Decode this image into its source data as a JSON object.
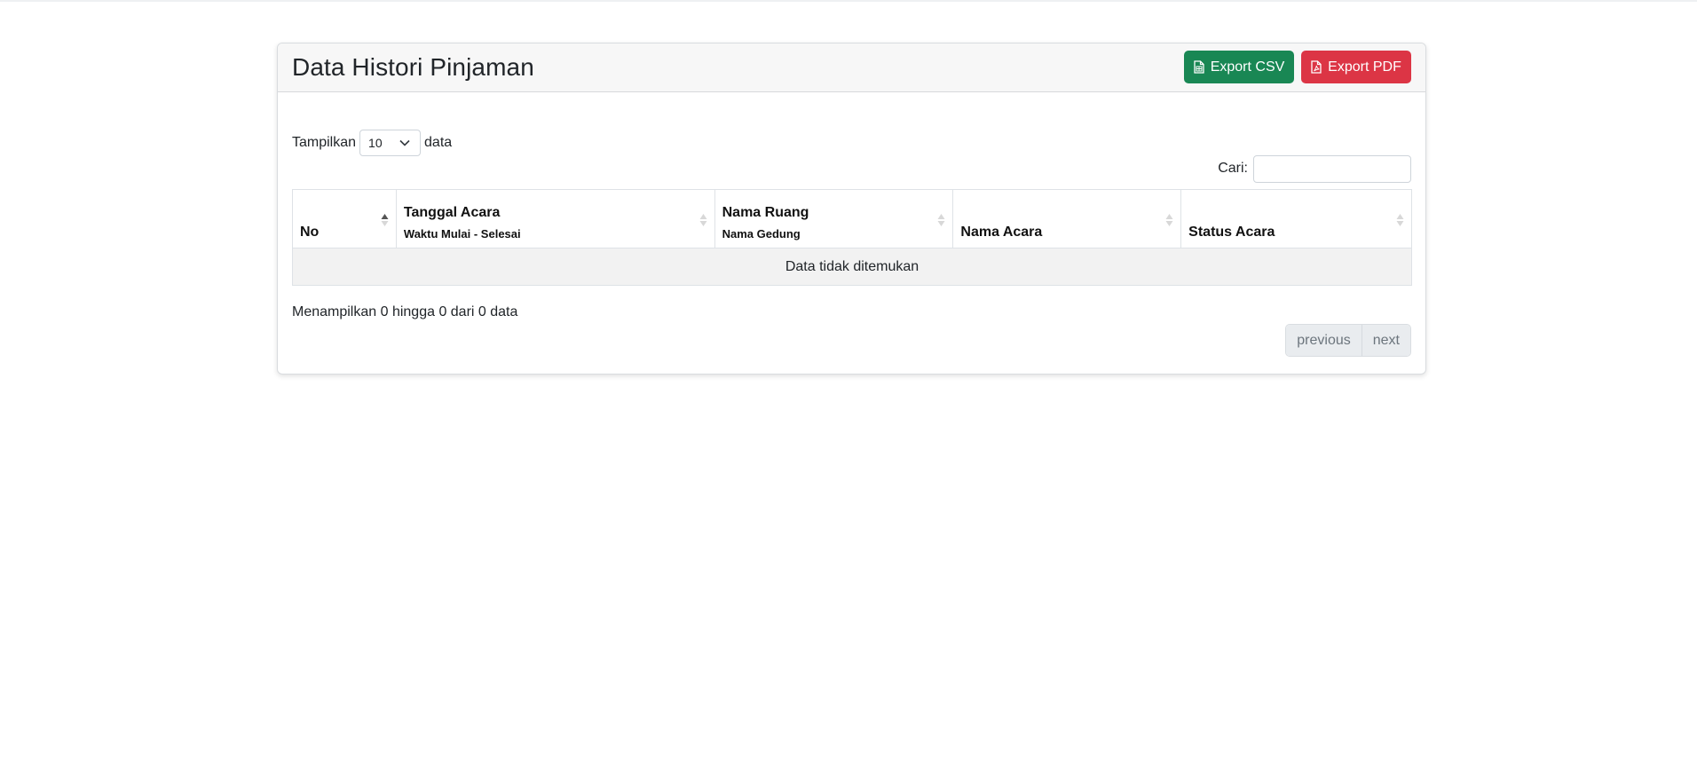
{
  "header": {
    "title": "Data Histori Pinjaman",
    "export_csv_label": "Export CSV",
    "export_pdf_label": "Export PDF",
    "csv_color": "#198754",
    "pdf_color": "#dc3545"
  },
  "length_menu": {
    "prefix": "Tampilkan",
    "selected": "10",
    "suffix": "data"
  },
  "search": {
    "label": "Cari:",
    "value": "",
    "placeholder": ""
  },
  "table": {
    "columns": [
      {
        "main": "No",
        "sub": ""
      },
      {
        "main": "Tanggal Acara",
        "sub": "Waktu Mulai - Selesai"
      },
      {
        "main": "Nama Ruang",
        "sub": "Nama Gedung"
      },
      {
        "main": "Nama Acara",
        "sub": ""
      },
      {
        "main": "Status Acara",
        "sub": ""
      }
    ],
    "empty_message": "Data tidak ditemukan"
  },
  "footer": {
    "info": "Menampilkan 0 hingga 0 dari 0 data",
    "previous_label": "previous",
    "next_label": "next"
  }
}
